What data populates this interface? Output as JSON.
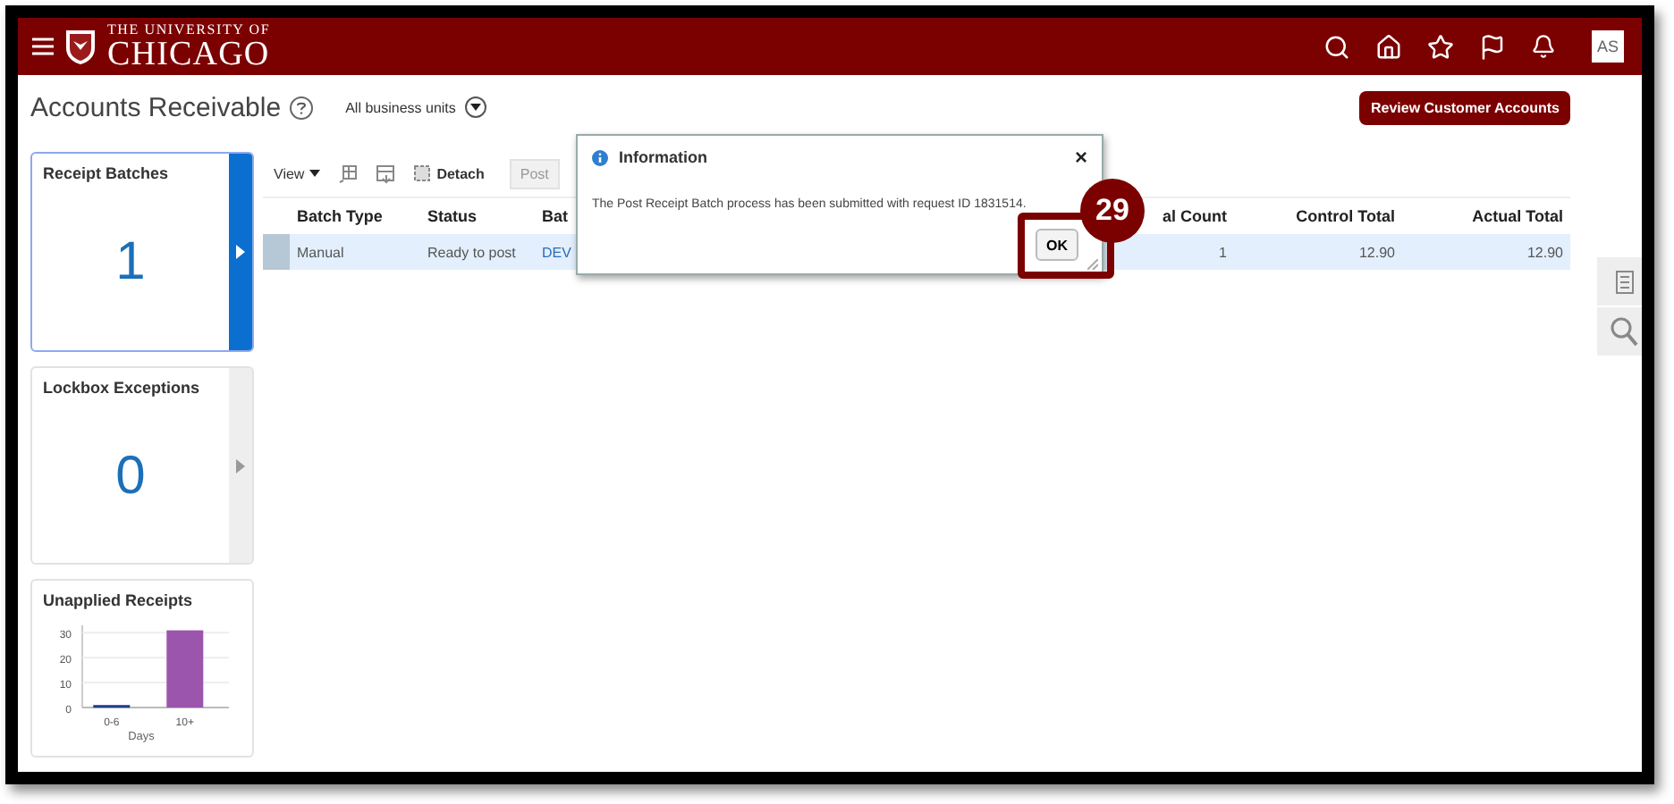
{
  "header": {
    "logo_top": "THE UNIVERSITY OF",
    "logo_bottom": "CHICAGO",
    "avatar": "AS"
  },
  "page": {
    "title": "Accounts Receivable",
    "business_unit": "All business units",
    "review_button": "Review Customer Accounts"
  },
  "cards": [
    {
      "title": "Receipt Batches",
      "kind": "count",
      "value": "1",
      "selected": true
    },
    {
      "title": "Lockbox Exceptions",
      "kind": "count",
      "value": "0",
      "selected": false
    },
    {
      "title": "Unapplied Receipts",
      "kind": "chart",
      "selected": false,
      "chart_data": {
        "type": "bar",
        "xlabel": "Days",
        "categories": [
          "0-6",
          "10+"
        ],
        "stacked": true,
        "grid": true,
        "yticks": [
          0,
          10,
          20,
          30
        ],
        "ylim": [
          0,
          33
        ],
        "series": [
          {
            "color": "#1f3f8f",
            "values": [
              1,
              null
            ]
          },
          {
            "color": "#9b55ad",
            "values": [
              null,
              31
            ]
          }
        ]
      }
    }
  ],
  "toolbar": {
    "view": "View",
    "detach": "Detach",
    "post": "Post"
  },
  "table": {
    "columns": [
      "Batch Type",
      "Status",
      "Bat",
      "al Count",
      "Control Total",
      "Actual Total"
    ],
    "rows": [
      {
        "selected": true,
        "cells": [
          "Manual",
          "Ready to post",
          "DEV",
          "1",
          "12.90",
          "12.90"
        ]
      }
    ]
  },
  "dialog": {
    "title": "Information",
    "message": "The Post Receipt Batch process has been submitted with request ID 1831514.",
    "ok": "OK",
    "close": "×"
  },
  "annotation": {
    "number": "29"
  }
}
